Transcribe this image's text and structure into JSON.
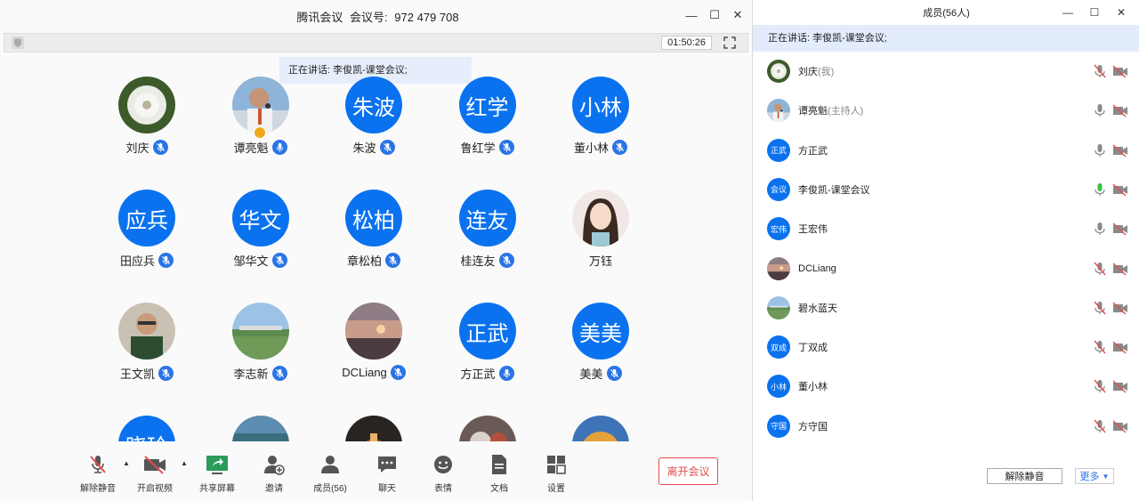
{
  "window": {
    "title": "腾讯会议",
    "meeting_id_label": "会议号:",
    "meeting_id": "972 479 708",
    "timer": "01:50:26"
  },
  "speaking_tip": "正在讲话: 李俊凯-课堂会议;",
  "grid": [
    {
      "name": "刘庆",
      "avatar_text": "",
      "avatar_kind": "dandelion",
      "mic": "muted"
    },
    {
      "name": "谭亮魁",
      "avatar_text": "",
      "avatar_kind": "photo-man-speaker",
      "mic": "on",
      "host": true
    },
    {
      "name": "朱波",
      "avatar_text": "朱波",
      "avatar_kind": "text",
      "mic": "muted"
    },
    {
      "name": "鲁红学",
      "avatar_text": "红学",
      "avatar_kind": "text",
      "mic": "muted"
    },
    {
      "name": "董小林",
      "avatar_text": "小林",
      "avatar_kind": "text",
      "mic": "muted"
    },
    {
      "name": "田应兵",
      "avatar_text": "应兵",
      "avatar_kind": "text",
      "mic": "muted"
    },
    {
      "name": "邹华文",
      "avatar_text": "华文",
      "avatar_kind": "text",
      "mic": "muted"
    },
    {
      "name": "章松柏",
      "avatar_text": "松柏",
      "avatar_kind": "text",
      "mic": "muted"
    },
    {
      "name": "桂连友",
      "avatar_text": "连友",
      "avatar_kind": "text",
      "mic": "muted"
    },
    {
      "name": "万钰",
      "avatar_text": "",
      "avatar_kind": "photo-woman",
      "mic": "none"
    },
    {
      "name": "王文凯",
      "avatar_text": "",
      "avatar_kind": "photo-man-glasses",
      "mic": "muted"
    },
    {
      "name": "李志新",
      "avatar_text": "",
      "avatar_kind": "photo-landscape",
      "mic": "muted"
    },
    {
      "name": "DCLiang",
      "avatar_text": "",
      "avatar_kind": "photo-sunset",
      "mic": "muted"
    },
    {
      "name": "方正武",
      "avatar_text": "正武",
      "avatar_kind": "text",
      "mic": "on"
    },
    {
      "name": "美美",
      "avatar_text": "美美",
      "avatar_kind": "text",
      "mic": "muted"
    },
    {
      "name": "",
      "avatar_text": "晓玲",
      "avatar_kind": "text",
      "mic": "none"
    },
    {
      "name": "",
      "avatar_text": "",
      "avatar_kind": "photo-water",
      "mic": "none"
    },
    {
      "name": "",
      "avatar_text": "",
      "avatar_kind": "photo-dark",
      "mic": "none"
    },
    {
      "name": "",
      "avatar_text": "",
      "avatar_kind": "photo-bike",
      "mic": "none"
    },
    {
      "name": "",
      "avatar_text": "",
      "avatar_kind": "photo-autumn",
      "mic": "none"
    }
  ],
  "bottom_toolbar": {
    "unmute": "解除静音",
    "start_video": "开启视频",
    "share_screen": "共享屏幕",
    "invite": "邀请",
    "members": "成员(56)",
    "chat": "聊天",
    "reactions": "表情",
    "docs": "文档",
    "settings": "设置",
    "leave": "离开会议"
  },
  "panel": {
    "title": "成员(56人)",
    "speaking": "正在讲话: 李俊凯-课堂会议;",
    "members": [
      {
        "name": "刘庆",
        "role": "(我)",
        "avatar_text": "",
        "avatar_kind": "dandelion",
        "mic": "muted",
        "cam": "off"
      },
      {
        "name": "谭亮魁",
        "role": "(主持人)",
        "avatar_text": "",
        "avatar_kind": "photo-man-speaker",
        "mic": "on",
        "cam": "off"
      },
      {
        "name": "方正武",
        "role": "",
        "avatar_text": "正武",
        "avatar_kind": "text",
        "mic": "on",
        "cam": "off"
      },
      {
        "name": "李俊凯-课堂会议",
        "role": "",
        "avatar_text": "会议",
        "avatar_kind": "text",
        "mic": "speaking",
        "cam": "off"
      },
      {
        "name": "王宏伟",
        "role": "",
        "avatar_text": "宏伟",
        "avatar_kind": "text",
        "mic": "on",
        "cam": "off"
      },
      {
        "name": "DCLiang",
        "role": "",
        "avatar_text": "",
        "avatar_kind": "photo-sunset",
        "mic": "muted",
        "cam": "off"
      },
      {
        "name": "碧水蓝天",
        "role": "",
        "avatar_text": "",
        "avatar_kind": "photo-landscape",
        "mic": "muted",
        "cam": "off"
      },
      {
        "name": "丁双成",
        "role": "",
        "avatar_text": "双成",
        "avatar_kind": "text",
        "mic": "muted",
        "cam": "off"
      },
      {
        "name": "董小林",
        "role": "",
        "avatar_text": "小林",
        "avatar_kind": "text",
        "mic": "muted",
        "cam": "off"
      },
      {
        "name": "方守国",
        "role": "",
        "avatar_text": "守国",
        "avatar_kind": "text",
        "mic": "muted",
        "cam": "off"
      }
    ],
    "unmute_all": "解除静音",
    "more": "更多"
  },
  "colors": {
    "accent": "#0a72ef",
    "muted_red": "#e34d4d",
    "speaking_green": "#3bbf4a"
  }
}
